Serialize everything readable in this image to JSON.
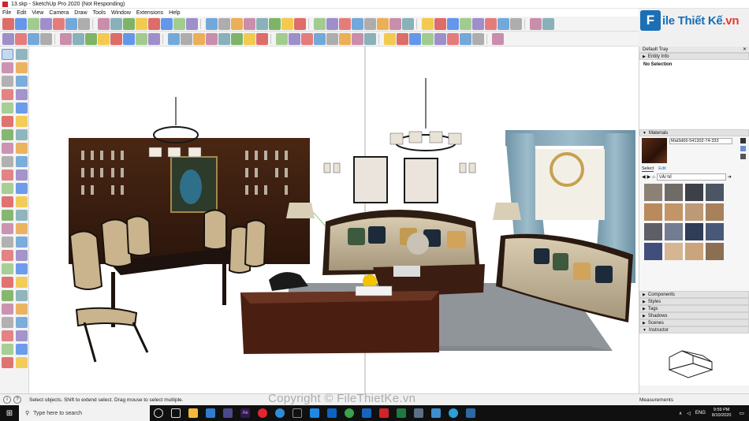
{
  "window": {
    "title": "13.skp - SketchUp Pro 2020 (Not Responding)"
  },
  "menu": [
    "File",
    "Edit",
    "View",
    "Camera",
    "Draw",
    "Tools",
    "Window",
    "Extensions",
    "Help"
  ],
  "logo": {
    "letter": "F",
    "text_main": "ile Thiết Kế",
    "text_suffix": ".vn"
  },
  "tray": {
    "title": "Default Tray",
    "entity_info": {
      "label": "Entity Info",
      "selection": "No Selection"
    },
    "materials": {
      "label": "Materials",
      "current_name": "Mat3d66-541302-74-333",
      "tabs": [
        "Select",
        "Edit"
      ],
      "library": "VẢI NỈ",
      "swatches": [
        "#8b8275",
        "#6f6b66",
        "#3d4147",
        "#4c5563",
        "#b88a5c",
        "#c29467",
        "#bc9a77",
        "#a7805c",
        "#5e5f66",
        "#737d91",
        "#2f3d57",
        "#4a5878",
        "#3f4e7a",
        "#d6b692",
        "#c9a47c",
        "#8c6f52"
      ]
    },
    "collapsed_panels": [
      "Components",
      "Styles",
      "Tags",
      "Shadows",
      "Scenes",
      "Instructor"
    ]
  },
  "status": {
    "hint": "Select objects. Shift to extend select. Drag mouse to select multiple.",
    "measurements_label": "Measurements"
  },
  "taskbar": {
    "search_placeholder": "Type here to search",
    "language": "ENG",
    "time": "9:59 PM",
    "date": "8/10/2020"
  },
  "watermark": "Copyright © FileThietKe.vn",
  "colors": {
    "accent": "#1a6fb5",
    "logo_red": "#e53935",
    "wood": "#3c1f12",
    "sofa_fabric": "#c9b99a",
    "curtain": "#7fa3b3"
  }
}
